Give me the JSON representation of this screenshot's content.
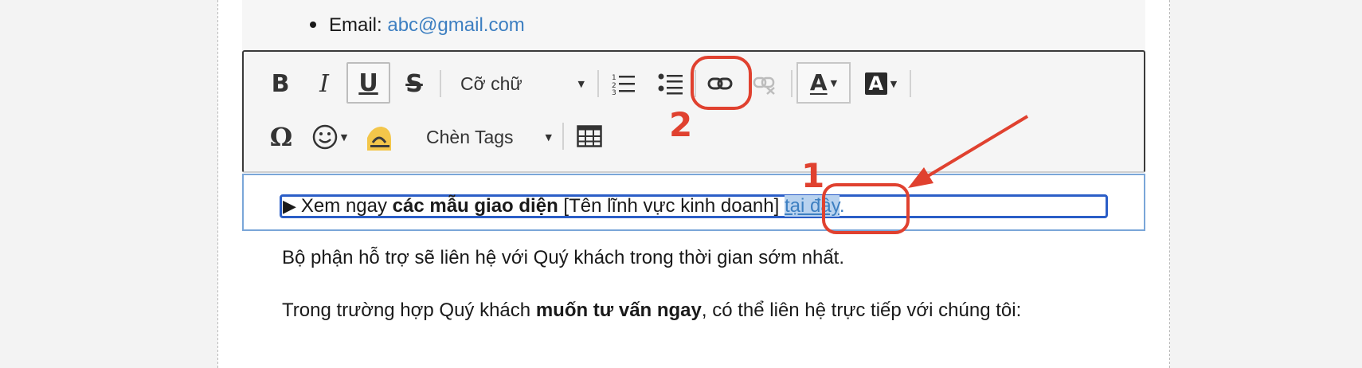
{
  "email": {
    "label": "Email:",
    "value": "abc@gmail.com"
  },
  "toolbar": {
    "bold_label": "B",
    "italic_label": "I",
    "underline_label": "U",
    "strike_label": "S",
    "font_size_label": "Cỡ chữ",
    "text_color_label": "A",
    "bg_color_label": "A",
    "special_char_label": "Ω",
    "tags_label": "Chèn Tags"
  },
  "editor": {
    "prefix": "Xem ngay",
    "bold_text": "các mẫu giao diện",
    "bracket_text": "[Tên lĩnh vực kinh doanh]",
    "link_text": "tại đây",
    "link_suffix": "."
  },
  "content": {
    "para1": "Bộ phận hỗ trợ sẽ liên hệ với Quý khách trong thời gian sớm nhất.",
    "para2_prefix": "Trong trường hợp Quý khách",
    "para2_bold": "muốn tư vấn ngay",
    "para2_suffix": ", có thể liên hệ trực tiếp với chúng tôi:"
  },
  "annotations": {
    "step1": "1",
    "step2": "2",
    "color": "#e0412f"
  },
  "icons": {
    "ordered_list": "ordered-list-icon",
    "unordered_list": "unordered-list-icon",
    "link": "link-icon",
    "unlink": "unlink-icon",
    "emoji": "emoji-icon",
    "highlight": "highlight-icon",
    "table": "table-icon"
  },
  "colors": {
    "link": "#3d7fc1",
    "selection": "#b8d2ef",
    "focus_border": "#2b5ec7",
    "annotation": "#e0412f"
  }
}
